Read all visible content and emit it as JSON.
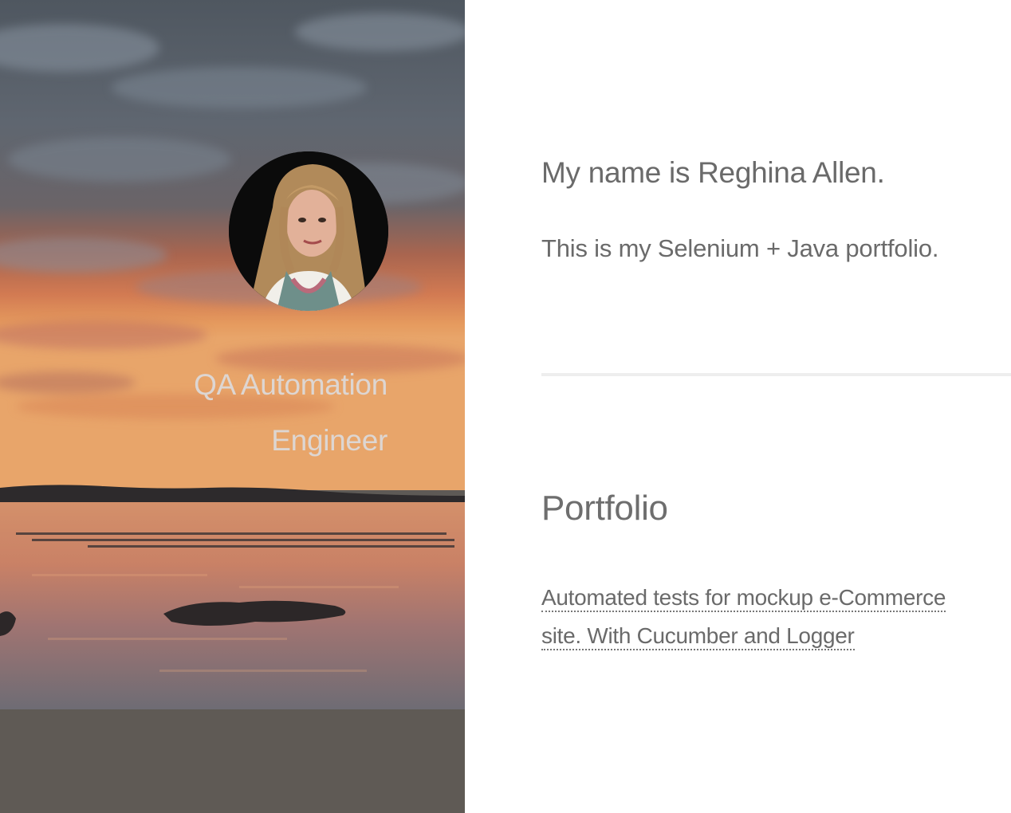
{
  "sidebar": {
    "job_title_line1": "QA Automation",
    "job_title_line2": "Engineer",
    "avatar_icon": "profile-photo-icon",
    "background_image": "sunset-lake-image"
  },
  "main": {
    "intro_name": "My name is Reghina Allen.",
    "intro_description": "This is my Selenium + Java portfolio.",
    "portfolio_heading": "Portfolio",
    "portfolio_link_line1": "Automated tests for mockup e-Commerce",
    "portfolio_link_line2": "site. With Cucumber and Logger"
  },
  "colors": {
    "text": "#6a6a6a",
    "sidebar_title": "#ddd6d2",
    "divider": "#eeeeee",
    "sidebar_footer": "#5f5a55"
  }
}
